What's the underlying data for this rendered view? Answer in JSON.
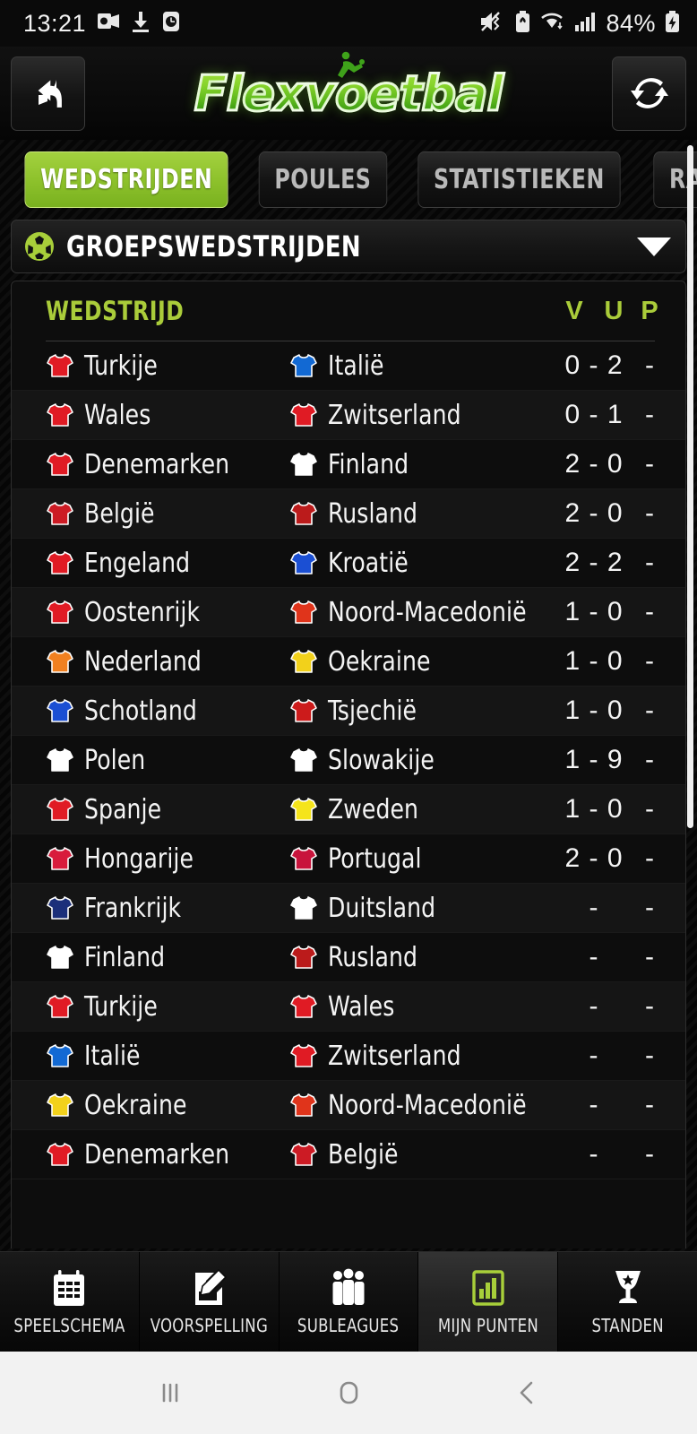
{
  "status_bar": {
    "time": "13:21",
    "battery_percent": "84%",
    "left_icons": [
      "outlook-icon",
      "download-icon",
      "clock-icon"
    ],
    "right_icons": [
      "mute-vibrate-icon",
      "battery-saver-icon",
      "wifi-icon",
      "signal-icon",
      "battery-charging-icon"
    ]
  },
  "header": {
    "back_button": "back-arrow-icon",
    "logo_text": "Flexvoetbal",
    "refresh_button": "refresh-icon"
  },
  "tabs": [
    {
      "label": "WEDSTRIJDEN",
      "active": true
    },
    {
      "label": "POULES",
      "active": false
    },
    {
      "label": "STATISTIEKEN",
      "active": false
    },
    {
      "label": "RANGLIJST",
      "active": false
    }
  ],
  "group_selector": {
    "icon": "soccer-ball-icon",
    "title": "GROEPSWEDSTRIJDEN",
    "caret": "chevron-down-icon"
  },
  "table": {
    "headers": {
      "match": "WEDSTRIJD",
      "v": "V",
      "u": "U",
      "p": "P"
    },
    "accent_color": "#aacc3a",
    "rows": [
      {
        "home": "Turkije",
        "home_color": "#e01b24",
        "away": "Italië",
        "away_color": "#1269d3",
        "score": "0 - 2",
        "points": "-"
      },
      {
        "home": "Wales",
        "home_color": "#e01b24",
        "away": "Zwitserland",
        "away_color": "#e01b24",
        "score": "0 - 1",
        "points": "-"
      },
      {
        "home": "Denemarken",
        "home_color": "#e01b24",
        "away": "Finland",
        "away_color": "#ffffff",
        "score": "2 - 0",
        "points": "-"
      },
      {
        "home": "België",
        "home_color": "#cc1b24",
        "away": "Rusland",
        "away_color": "#bb1b1b",
        "score": "2 - 0",
        "points": "-"
      },
      {
        "home": "Engeland",
        "home_color": "#e01b24",
        "away": "Kroatië",
        "away_color": "#1b4fd3",
        "score": "2 - 2",
        "points": "-"
      },
      {
        "home": "Oostenrijk",
        "home_color": "#e01b24",
        "away": "Noord-Macedonië",
        "away_color": "#e0341b",
        "score": "1 - 0",
        "points": "-"
      },
      {
        "home": "Nederland",
        "home_color": "#f08020",
        "away": "Oekraine",
        "away_color": "#f2d11b",
        "score": "1 - 0",
        "points": "-"
      },
      {
        "home": "Schotland",
        "home_color": "#1b4fd3",
        "away": "Tsjechië",
        "away_color": "#cc1b1b",
        "score": "1 - 0",
        "points": "-"
      },
      {
        "home": "Polen",
        "home_color": "#ffffff",
        "away": "Slowakije",
        "away_color": "#ffffff",
        "score": "1 - 9",
        "points": "-"
      },
      {
        "home": "Spanje",
        "home_color": "#e01b24",
        "away": "Zweden",
        "away_color": "#f5e41b",
        "score": "1 - 0",
        "points": "-"
      },
      {
        "home": "Hongarije",
        "home_color": "#d81b3c",
        "away": "Portugal",
        "away_color": "#c8143c",
        "score": "2 - 0",
        "points": "-"
      },
      {
        "home": "Frankrijk",
        "home_color": "#1b2f7a",
        "away": "Duitsland",
        "away_color": "#ffffff",
        "score": "-",
        "points": "-"
      },
      {
        "home": "Finland",
        "home_color": "#ffffff",
        "away": "Rusland",
        "away_color": "#bb1b1b",
        "score": "-",
        "points": "-"
      },
      {
        "home": "Turkije",
        "home_color": "#e01b24",
        "away": "Wales",
        "away_color": "#e01b24",
        "score": "-",
        "points": "-"
      },
      {
        "home": "Italië",
        "home_color": "#1269d3",
        "away": "Zwitserland",
        "away_color": "#e01b24",
        "score": "-",
        "points": "-"
      },
      {
        "home": "Oekraine",
        "home_color": "#f2d11b",
        "away": "Noord-Macedonië",
        "away_color": "#e0341b",
        "score": "-",
        "points": "-"
      },
      {
        "home": "Denemarken",
        "home_color": "#e01b24",
        "away": "België",
        "away_color": "#cc1b24",
        "score": "-",
        "points": "-"
      }
    ]
  },
  "bottom_nav": [
    {
      "label": "SPEELSCHEMA",
      "icon": "calendar-icon",
      "active": false
    },
    {
      "label": "VOORSPELLING",
      "icon": "pencil-edit-icon",
      "active": false
    },
    {
      "label": "SUBLEAGUES",
      "icon": "people-icon",
      "active": false
    },
    {
      "label": "MIJN PUNTEN",
      "icon": "bar-chart-icon",
      "active": true
    },
    {
      "label": "STANDEN",
      "icon": "trophy-icon",
      "active": false
    }
  ],
  "android_nav": {
    "recents": "recents-icon",
    "home": "home-icon",
    "back": "back-icon"
  },
  "colors": {
    "accent_green": "#8ec22c",
    "label_green": "#aacc3a",
    "background": "#0a0a0a"
  }
}
